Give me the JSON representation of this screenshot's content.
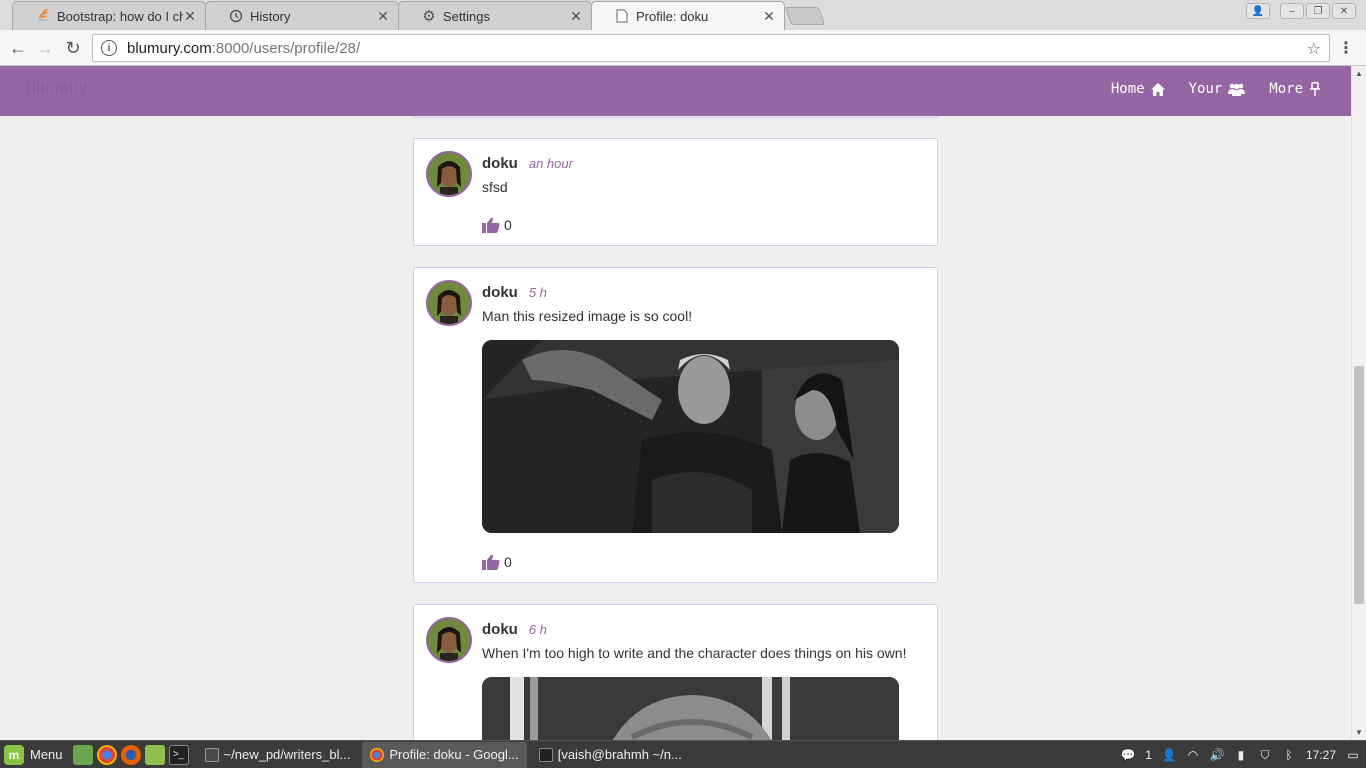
{
  "browser": {
    "tabs": [
      {
        "title": "Bootstrap: how do I cha",
        "icon": "stackoverflow-icon",
        "active": false
      },
      {
        "title": "History",
        "icon": "history-icon",
        "active": false
      },
      {
        "title": "Settings",
        "icon": "gear-icon",
        "active": false
      },
      {
        "title": "Profile: doku",
        "icon": "document-icon",
        "active": true
      }
    ],
    "url_host": "blumury.com",
    "url_path": ":8000/users/profile/28/"
  },
  "site": {
    "brand": "Blumury",
    "accent_color": "#9565a4",
    "nav": [
      {
        "label": "Home",
        "icon": "home-icon"
      },
      {
        "label": "Your",
        "icon": "users-icon"
      },
      {
        "label": "More",
        "icon": "pin-icon"
      }
    ]
  },
  "posts": [
    {
      "author": "doku",
      "time": "an hour",
      "text": "sfsd",
      "likes": "0",
      "has_image": false
    },
    {
      "author": "doku",
      "time": "5 h",
      "text": "Man this resized image is so cool!",
      "likes": "0",
      "has_image": true
    },
    {
      "author": "doku",
      "time": "6 h",
      "text": "When I'm too high to write and the character does things on his own!",
      "likes": "",
      "has_image": true
    }
  ],
  "taskbar": {
    "menu_label": "Menu",
    "windows": [
      {
        "label": "~/new_pd/writers_bl...",
        "icon": "sublime-icon",
        "active": false
      },
      {
        "label": "Profile: doku - Googl...",
        "icon": "chrome-icon",
        "active": true
      },
      {
        "label": "[vaish@brahmh ~/n...",
        "icon": "terminal-icon",
        "active": false
      }
    ],
    "notifications": "1",
    "clock": "17:27"
  }
}
